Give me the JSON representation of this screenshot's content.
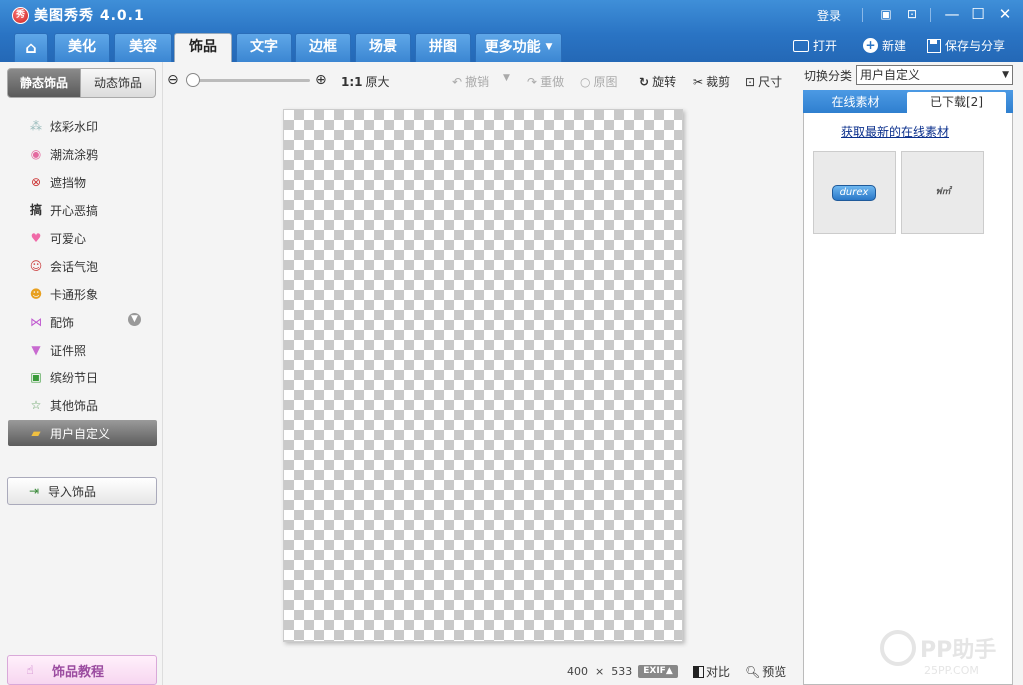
{
  "window": {
    "title": "美图秀秀 4.0.1",
    "logo_text": "秀",
    "login": "登录"
  },
  "tabs": [
    {
      "label": "美化"
    },
    {
      "label": "美容"
    },
    {
      "label": "饰品"
    },
    {
      "label": "文字"
    },
    {
      "label": "边框"
    },
    {
      "label": "场景"
    },
    {
      "label": "拼图"
    },
    {
      "label": "更多功能"
    }
  ],
  "header_actions": {
    "open": "打开",
    "new": "新建",
    "save_share": "保存与分享"
  },
  "left_panel": {
    "tab_static": "静态饰品",
    "tab_dynamic": "动态饰品",
    "categories": [
      {
        "label": "炫彩水印",
        "icon": "sparkle-icon"
      },
      {
        "label": "潮流涂鸦",
        "icon": "lips-icon"
      },
      {
        "label": "遮挡物",
        "icon": "block-icon"
      },
      {
        "label": "开心恶搞",
        "icon": "prank-icon",
        "glyph": "搞"
      },
      {
        "label": "可爱心",
        "icon": "heart-icon"
      },
      {
        "label": "会话气泡",
        "icon": "speech-bubble-icon"
      },
      {
        "label": "卡通形象",
        "icon": "cartoon-face-icon"
      },
      {
        "label": "配饰",
        "icon": "bow-icon"
      },
      {
        "label": "证件照",
        "icon": "shirt-icon"
      },
      {
        "label": "缤纷节日",
        "icon": "gift-icon"
      },
      {
        "label": "其他饰品",
        "icon": "star-icon"
      },
      {
        "label": "用户自定义",
        "icon": "folder-icon"
      }
    ],
    "import_button": "导入饰品",
    "tutorial_button": "饰品教程"
  },
  "toolbar": {
    "zoom_level": 0.0,
    "one_to_one": "1:1",
    "original_size": "原大",
    "undo": "撤销",
    "redo": "重做",
    "original": "原图",
    "rotate": "旋转",
    "crop": "裁剪",
    "resize": "尺寸"
  },
  "status": {
    "width": "400",
    "times": "×",
    "height": "533",
    "exif": "EXIF▲",
    "compare": "对比",
    "preview": "预览"
  },
  "right_panel": {
    "category_label": "切换分类",
    "category_value": "用户自定义",
    "tab_online": "在线素材",
    "tab_downloaded": "已下载[2]",
    "fetch_link": "获取最新的在线素材",
    "thumbnails": [
      {
        "text": "durex"
      },
      {
        "text": "ฟ㎡"
      }
    ]
  },
  "watermark": {
    "brand": "PP助手",
    "domain": "25PP.COM"
  },
  "colors": {
    "title_bar": "#2a74c4",
    "active_category": "#5c5c5c",
    "link": "#0a2f8c"
  }
}
